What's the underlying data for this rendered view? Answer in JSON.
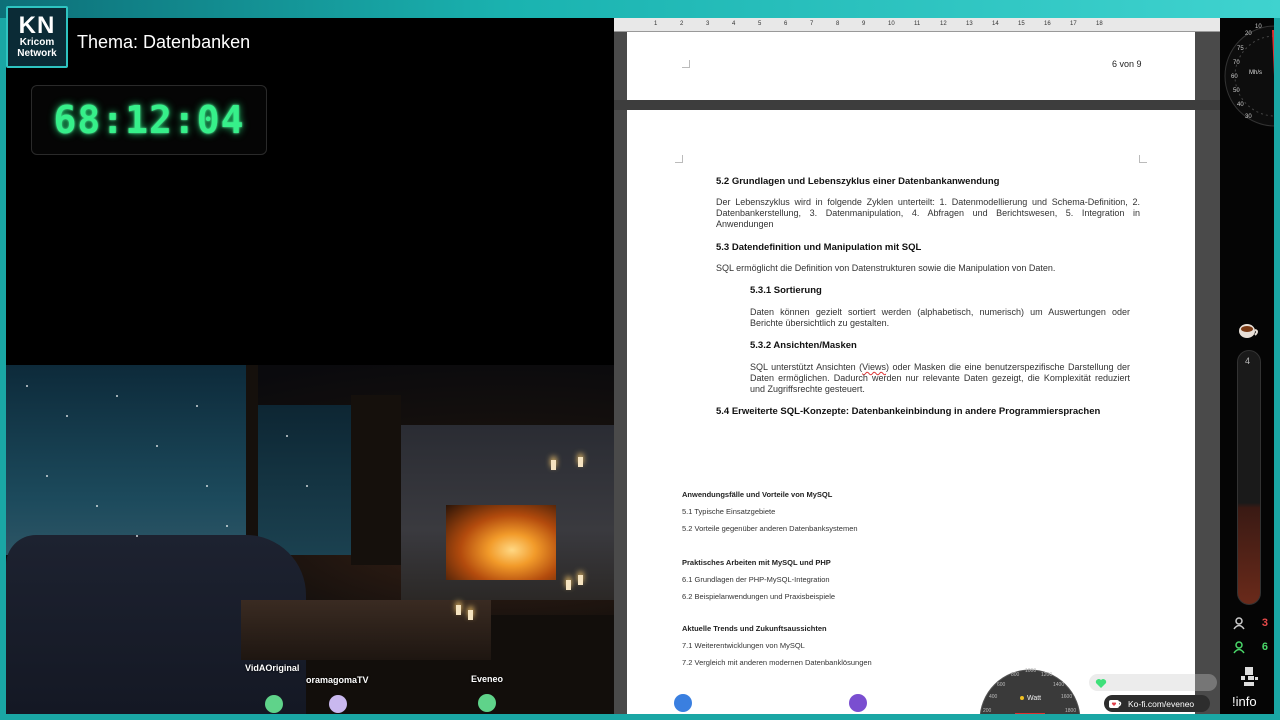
{
  "header": {
    "logo_text": "KN",
    "logo_sub1": "Kricom",
    "logo_sub2": "Network",
    "topic": "Thema: Datenbanken",
    "timer": "68:12:04"
  },
  "viewers": [
    {
      "name": "VidAOriginal",
      "color": "#5fd38a"
    },
    {
      "name": "oramagomaTV",
      "color": "#c9b8ef"
    },
    {
      "name": "Eveneo",
      "color": "#5fd38a"
    },
    {
      "name": "",
      "color": "#3a7fe0"
    },
    {
      "name": "",
      "color": "#7a4ed0"
    }
  ],
  "document": {
    "ruler_marks": [
      "1",
      "2",
      "3",
      "4",
      "5",
      "6",
      "7",
      "8",
      "9",
      "10",
      "11",
      "12",
      "13",
      "14",
      "15",
      "16",
      "17",
      "18"
    ],
    "page_number": "6 von 9",
    "sections": {
      "s52_title": "5.2 Grundlagen und Lebenszyklus einer Datenbankanwendung",
      "s52_text": "Der Lebenszyklus wird in folgende Zyklen unterteilt: 1. Datenmodellierung und Schema-Definition, 2. Datenbankerstellung, 3. Datenmanipulation, 4. Abfragen und Berichtswesen, 5. Integration in Anwendungen",
      "s53_title": "5.3 Datendefinition und Manipulation mit SQL",
      "s53_text": "SQL ermöglicht die Definition von Datenstrukturen sowie die Manipulation von Daten.",
      "s531_title": "5.3.1 Sortierung",
      "s531_text": "Daten können gezielt sortiert werden (alphabetisch, numerisch) um Auswertungen oder Berichte übersichtlich zu gestalten.",
      "s532_title": "5.3.2 Ansichten/Masken",
      "s532_text_a": "SQL unterstützt Ansichten (",
      "s532_text_views": "Views",
      "s532_text_b": ") oder Masken die eine benutzerspezifische Darstellung der Daten ermöglichen. Dadurch werden nur relevante Daten gezeigt, die Komplexität reduziert und Zugriffsrechte gesteuert.",
      "s54_title": "5.4 Erweiterte SQL-Konzepte: Datenbankeinbindung in andere Programmiersprachen"
    },
    "outline": [
      {
        "type": "h",
        "text": "Anwendungsfälle und Vorteile von MySQL"
      },
      {
        "type": "i",
        "text": "5.1 Typische Einsatzgebiete"
      },
      {
        "type": "i",
        "text": "5.2 Vorteile gegenüber anderen Datenbanksystemen"
      },
      {
        "type": "h",
        "text": "Praktisches Arbeiten mit MySQL und PHP"
      },
      {
        "type": "i",
        "text": "6.1 Grundlagen der PHP-MySQL-Integration"
      },
      {
        "type": "i",
        "text": "6.2 Beispielanwendungen und Praxisbeispiele"
      },
      {
        "type": "h",
        "text": "Aktuelle Trends und Zukunftsaussichten"
      },
      {
        "type": "i",
        "text": "7.1 Weiterentwicklungen von MySQL"
      },
      {
        "type": "i",
        "text": "7.2 Vergleich mit anderen modernen Datenbanklösungen"
      }
    ]
  },
  "sidebar": {
    "gauge_label": "Mh/s",
    "gauge_ticks": [
      "10",
      "20",
      "30",
      "40",
      "50",
      "60",
      "70",
      "75"
    ],
    "tube_value": "4",
    "stat_1": "3",
    "stat_2": "6",
    "info_label": "!info"
  },
  "bottom": {
    "watt_label": "Watt",
    "watt_ticks": [
      "200",
      "400",
      "600",
      "800",
      "1000",
      "1200",
      "1400",
      "1600",
      "1800"
    ],
    "kofi_label": "Ko-fi.com/eveneo"
  },
  "colors": {
    "accent": "#1aa7a5",
    "timer": "#36f08a",
    "stat_red": "#e84a4a",
    "stat_green": "#4ad86a"
  }
}
